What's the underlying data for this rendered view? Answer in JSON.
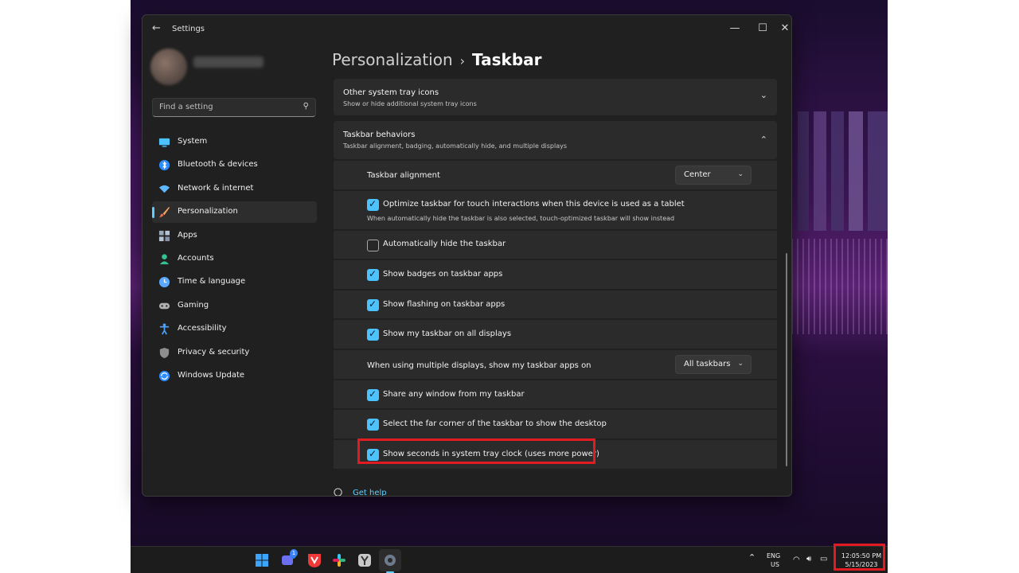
{
  "window": {
    "title": "Settings",
    "controls": {
      "minimize": "—",
      "maximize": "☐",
      "close": "✕"
    }
  },
  "search": {
    "placeholder": "Find a setting"
  },
  "sidebar": {
    "items": [
      {
        "label": "System",
        "icon": "monitor-icon",
        "color": "#4cc2ff"
      },
      {
        "label": "Bluetooth & devices",
        "icon": "bluetooth-icon",
        "color": "#2a8dff"
      },
      {
        "label": "Network & internet",
        "icon": "wifi-icon",
        "color": "#5fb8ff"
      },
      {
        "label": "Personalization",
        "icon": "brush-icon",
        "color": "#f4a261",
        "active": true
      },
      {
        "label": "Apps",
        "icon": "apps-icon",
        "color": "#9aa7b8"
      },
      {
        "label": "Accounts",
        "icon": "person-icon",
        "color": "#34c38f"
      },
      {
        "label": "Time & language",
        "icon": "clock-globe-icon",
        "color": "#5aa9ff"
      },
      {
        "label": "Gaming",
        "icon": "controller-icon",
        "color": "#b0b0b0"
      },
      {
        "label": "Accessibility",
        "icon": "accessibility-icon",
        "color": "#4aa3ff"
      },
      {
        "label": "Privacy & security",
        "icon": "shield-icon",
        "color": "#8e8e8e"
      },
      {
        "label": "Windows Update",
        "icon": "update-icon",
        "color": "#2f8cff"
      }
    ]
  },
  "breadcrumb": {
    "parent": "Personalization",
    "separator": "›",
    "current": "Taskbar"
  },
  "sections": {
    "other_tray": {
      "title": "Other system tray icons",
      "subtitle": "Show or hide additional system tray icons",
      "chevron": "⌄"
    },
    "behaviors": {
      "title": "Taskbar behaviors",
      "subtitle": "Taskbar alignment, badging, automatically hide, and multiple displays",
      "chevron": "⌃"
    }
  },
  "settings": {
    "alignment": {
      "label": "Taskbar alignment",
      "value": "Center"
    },
    "touch": {
      "label": "Optimize taskbar for touch interactions when this device is used as a tablet",
      "note": "When automatically hide the taskbar is also selected, touch-optimized taskbar will show instead",
      "checked": true
    },
    "autohide": {
      "label": "Automatically hide the taskbar",
      "checked": false
    },
    "badges": {
      "label": "Show badges on taskbar apps",
      "checked": true
    },
    "flashing": {
      "label": "Show flashing on taskbar apps",
      "checked": true
    },
    "all_displays": {
      "label": "Show my taskbar on all displays",
      "checked": true
    },
    "multi_display": {
      "label": "When using multiple displays, show my taskbar apps on",
      "value": "All taskbars"
    },
    "share_window": {
      "label": "Share any window from my taskbar",
      "checked": true
    },
    "far_corner": {
      "label": "Select the far corner of the taskbar to show the desktop",
      "checked": true
    },
    "show_seconds": {
      "label": "Show seconds in system tray clock (uses more power)",
      "checked": true
    }
  },
  "help": {
    "label": "Get help"
  },
  "taskbar": {
    "apps": [
      "windows-start-icon",
      "teams-chat-icon",
      "vivaldi-browser-icon",
      "slack-icon",
      "yandex-browser-icon",
      "settings-gear-icon"
    ],
    "teams_badge": "1",
    "tray": {
      "chevron": "⌃",
      "lang_top": "ENG",
      "lang_bottom": "US"
    },
    "clock": {
      "time": "12:05:50 PM",
      "date": "5/15/2023"
    }
  },
  "colors": {
    "accent": "#4cc2ff",
    "highlight": "#e21b23",
    "window_bg": "#202020",
    "card_bg": "#2b2b2b"
  }
}
